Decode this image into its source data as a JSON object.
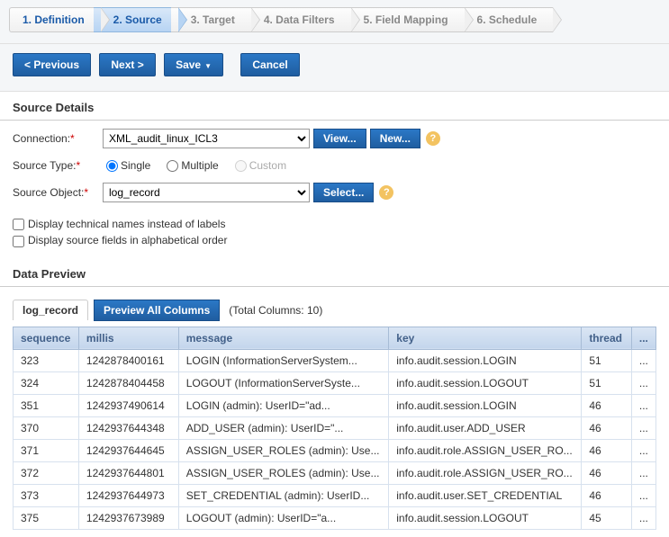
{
  "wizard": {
    "steps": [
      {
        "label": "1. Definition"
      },
      {
        "label": "2. Source"
      },
      {
        "label": "3. Target"
      },
      {
        "label": "4. Data Filters"
      },
      {
        "label": "5. Field Mapping"
      },
      {
        "label": "6. Schedule"
      }
    ]
  },
  "actions": {
    "previous": "< Previous",
    "next": "Next >",
    "save": "Save",
    "cancel": "Cancel"
  },
  "sourceDetails": {
    "title": "Source Details",
    "connectionLabel": "Connection:",
    "connectionValue": "XML_audit_linux_ICL3",
    "viewBtn": "View...",
    "newBtn": "New...",
    "sourceTypeLabel": "Source Type:",
    "typeSingle": "Single",
    "typeMultiple": "Multiple",
    "typeCustom": "Custom",
    "sourceObjectLabel": "Source Object:",
    "sourceObjectValue": "log_record",
    "selectBtn": "Select...",
    "checkTechnical": "Display technical names instead of labels",
    "checkAlpha": "Display source fields in alphabetical order"
  },
  "dataPreview": {
    "title": "Data Preview",
    "tabLabel": "log_record",
    "previewAllBtn": "Preview All Columns",
    "totalColumns": "(Total Columns: 10)",
    "columns": [
      "sequence",
      "millis",
      "message",
      "key",
      "thread",
      "..."
    ],
    "rows": [
      {
        "sequence": "323",
        "millis": "1242878400161",
        "message": "LOGIN (InformationServerSystem...",
        "key": "info.audit.session.LOGIN",
        "thread": "51",
        "more": "..."
      },
      {
        "sequence": "324",
        "millis": "1242878404458",
        "message": "LOGOUT (InformationServerSyste...",
        "key": "info.audit.session.LOGOUT",
        "thread": "51",
        "more": "..."
      },
      {
        "sequence": "351",
        "millis": "1242937490614",
        "message": "LOGIN (admin): UserID=\"ad...",
        "key": "info.audit.session.LOGIN",
        "thread": "46",
        "more": "..."
      },
      {
        "sequence": "370",
        "millis": "1242937644348",
        "message": "ADD_USER (admin): UserID=\"...",
        "key": "info.audit.user.ADD_USER",
        "thread": "46",
        "more": "..."
      },
      {
        "sequence": "371",
        "millis": "1242937644645",
        "message": "ASSIGN_USER_ROLES (admin): Use...",
        "key": "info.audit.role.ASSIGN_USER_RO...",
        "thread": "46",
        "more": "..."
      },
      {
        "sequence": "372",
        "millis": "1242937644801",
        "message": "ASSIGN_USER_ROLES (admin): Use...",
        "key": "info.audit.role.ASSIGN_USER_RO...",
        "thread": "46",
        "more": "..."
      },
      {
        "sequence": "373",
        "millis": "1242937644973",
        "message": "SET_CREDENTIAL (admin): UserID...",
        "key": "info.audit.user.SET_CREDENTIAL",
        "thread": "46",
        "more": "..."
      },
      {
        "sequence": "375",
        "millis": "1242937673989",
        "message": "LOGOUT (admin): UserID=\"a...",
        "key": "info.audit.session.LOGOUT",
        "thread": "45",
        "more": "..."
      }
    ]
  }
}
